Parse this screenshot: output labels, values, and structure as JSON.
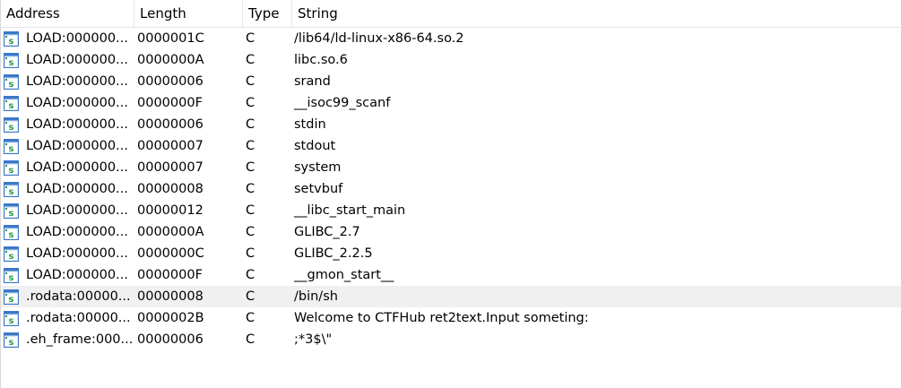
{
  "columns": {
    "address": "Address",
    "length": "Length",
    "type": "Type",
    "string": "String"
  },
  "rows": [
    {
      "address": "LOAD:000000...",
      "length": "0000001C",
      "type": "C",
      "string": "/lib64/ld-linux-x86-64.so.2",
      "icon": "string-icon"
    },
    {
      "address": "LOAD:000000...",
      "length": "0000000A",
      "type": "C",
      "string": "libc.so.6",
      "icon": "string-icon"
    },
    {
      "address": "LOAD:000000...",
      "length": "00000006",
      "type": "C",
      "string": "srand",
      "icon": "string-icon"
    },
    {
      "address": "LOAD:000000...",
      "length": "0000000F",
      "type": "C",
      "string": "__isoc99_scanf",
      "icon": "string-icon"
    },
    {
      "address": "LOAD:000000...",
      "length": "00000006",
      "type": "C",
      "string": "stdin",
      "icon": "string-icon"
    },
    {
      "address": "LOAD:000000...",
      "length": "00000007",
      "type": "C",
      "string": "stdout",
      "icon": "string-icon"
    },
    {
      "address": "LOAD:000000...",
      "length": "00000007",
      "type": "C",
      "string": "system",
      "icon": "string-icon"
    },
    {
      "address": "LOAD:000000...",
      "length": "00000008",
      "type": "C",
      "string": "setvbuf",
      "icon": "string-icon"
    },
    {
      "address": "LOAD:000000...",
      "length": "00000012",
      "type": "C",
      "string": "__libc_start_main",
      "icon": "string-icon"
    },
    {
      "address": "LOAD:000000...",
      "length": "0000000A",
      "type": "C",
      "string": "GLIBC_2.7",
      "icon": "string-icon"
    },
    {
      "address": "LOAD:000000...",
      "length": "0000000C",
      "type": "C",
      "string": "GLIBC_2.2.5",
      "icon": "string-icon"
    },
    {
      "address": "LOAD:000000...",
      "length": "0000000F",
      "type": "C",
      "string": "__gmon_start__",
      "icon": "string-icon"
    },
    {
      "address": ".rodata:00000...",
      "length": "00000008",
      "type": "C",
      "string": "/bin/sh",
      "icon": "string-icon",
      "selected": true
    },
    {
      "address": ".rodata:00000...",
      "length": "0000002B",
      "type": "C",
      "string": "Welcome to CTFHub ret2text.Input someting:",
      "icon": "string-icon"
    },
    {
      "address": ".eh_frame:000...",
      "length": "00000006",
      "type": "C",
      "string": ";*3$\\\"",
      "icon": "string-icon"
    }
  ],
  "colors": {
    "selected_row": "#f0f0f0",
    "icon_blue": "#3b78c8",
    "icon_green": "#2e9b45"
  }
}
